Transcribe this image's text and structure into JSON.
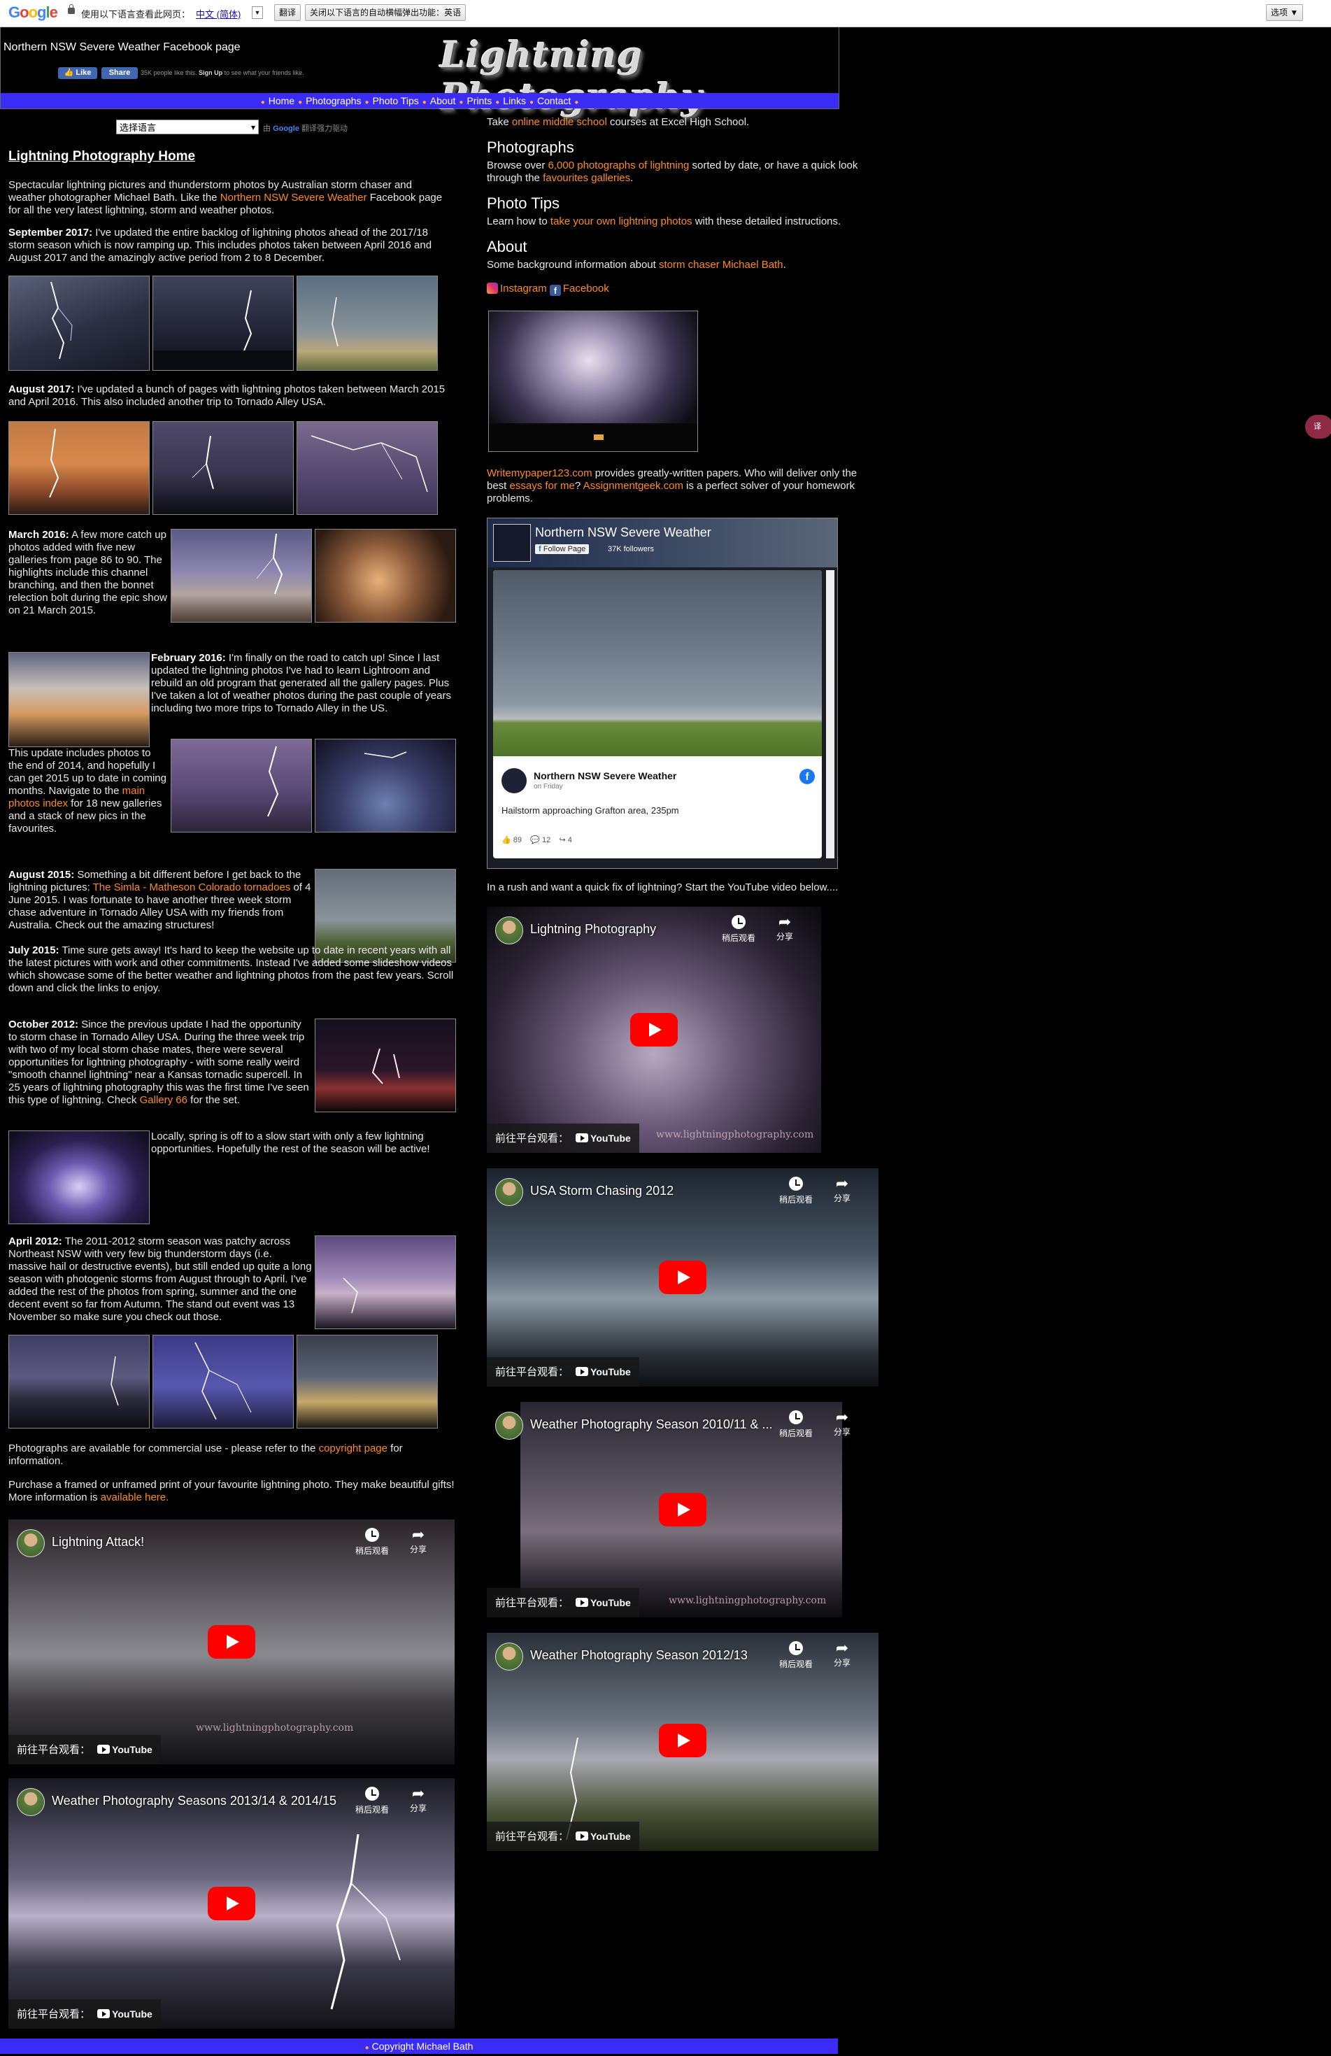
{
  "translate_bar": {
    "logo": "Google",
    "prompt": "使用以下语言查看此网页：",
    "language": "中文 (简体)",
    "translate_button": "翻译",
    "disable_button": "关闭以下语言的自动横幅弹出功能：英语",
    "options_button": "选项 ▼"
  },
  "header": {
    "fb_title": "Northern NSW Severe Weather Facebook page",
    "fb_like": "Like",
    "fb_share": "Share",
    "fb_note_prefix": "35K people like this.",
    "fb_note_signup": "Sign Up",
    "fb_note_suffix": "to see what your friends like.",
    "logo_text": "Lightning Photography"
  },
  "nav": {
    "items": [
      "Home",
      "Photographs",
      "Photo Tips",
      "About",
      "Prints",
      "Links",
      "Contact"
    ]
  },
  "language_select": {
    "value": "选择语言",
    "powered_prefix": "由",
    "powered_brand": "Google",
    "powered_suffix": "翻译强力驱动"
  },
  "main": {
    "home_title": "Lightning Photography Home",
    "intro_1": "Spectacular lightning pictures and thunderstorm photos by Australian storm chaser and weather photographer Michael Bath. Like the",
    "intro_link": "Northern NSW Severe Weather",
    "intro_2": "Facebook page for all the very latest lightning, storm and weather photos.",
    "sep2017_label": "September 2017:",
    "sep2017_text": "I've updated the entire backlog of lightning photos ahead of the 2017/18 storm season which is now ramping up. This includes photos taken between April 2016 and August 2017 and the amazingly active period from 2 to 8 December.",
    "aug2017_label": "August 2017:",
    "aug2017_text": "I've updated a bunch of pages with lightning photos taken between March 2015 and April 2016. This also included another trip to Tornado Alley USA.",
    "mar2016_label": "March 2016:",
    "mar2016_text": "A few more catch up photos added with five new galleries from page 86 to 90. The highlights include this channel branching, and then the bonnet relection bolt during the epic show on 21 March 2015.",
    "feb2016_label": "February 2016:",
    "feb2016_text": "I'm finally on the road to catch up! Since I last updated the lightning photos I've had to learn Lightroom and rebuild an old program that generated all the gallery pages. Plus I've taken a lot of weather photos during the past couple of years including two more trips to Tornado Alley in the US.",
    "feb2016_text2": "This update includes photos to the end of 2014, and hopefully I can get 2015 up to date in coming months. Navigate to the",
    "feb2016_link": "main photos index",
    "feb2016_text3": "for 18 new galleries and a stack of new pics in the favourites.",
    "aug2015_label": "August 2015:",
    "aug2015_text": "Something a bit different before I get back to the lightning pictures:",
    "aug2015_link": "The Simla - Matheson Colorado tornadoes",
    "aug2015_text2": "of 4 June 2015. I was fortunate to have another three week storm chase adventure in Tornado Alley USA with my friends from Australia. Check out the amazing structures!",
    "jul2015_label": "July 2015:",
    "jul2015_text": "Time sure gets away! It's hard to keep the website up to date in recent years with all the latest pictures with work and other commitments. Instead I've added some slideshow videos which showcase some of the better weather and lightning photos from the past few years. Scroll down and click the links to enjoy.",
    "oct2012_label": "October 2012:",
    "oct2012_text": "Since the previous update I had the opportunity to storm chase in Tornado Alley USA. During the three week trip with two of my local storm chase mates, there were several opportunities for lightning photography - with some really weird \"smooth channel lightning\" near a Kansas tornadic supercell. In 25 years of lightning photography this was the first time I've seen this type of lightning. Check",
    "oct2012_link": "Gallery 66",
    "oct2012_text2": "for the set.",
    "spring_text": "Locally, spring is off to a slow start with only a few lightning opportunities. Hopefully the rest of the season will be active!",
    "apr2012_label": "April 2012:",
    "apr2012_text": "The 2011-2012 storm season was patchy across Northeast NSW with very few big thunderstorm days (i.e. massive hail or destructive events), but still ended up quite a long season with photogenic storms from August through to April. I've added the rest of the photos from spring, summer and the one decent event so far from Autumn. The stand out event was 13 November so make sure you check out those.",
    "commercial_text": "Photographs are available for commercial use - please refer to the",
    "commercial_link": "copyright page",
    "commercial_text2": "for information.",
    "purchase_text": "Purchase a framed or unframed print of your favourite lightning photo. They make beautiful gifts! More information is",
    "purchase_link": "available here."
  },
  "sidebar": {
    "course_prefix": "Take",
    "course_link": "online middle school",
    "course_suffix": "courses at Excel High School.",
    "photographs_heading": "Photographs",
    "photographs_prefix": "Browse over",
    "photographs_link": "6,000 photographs of lightning",
    "photographs_mid": "sorted by date, or have a quick look through the",
    "photographs_link2": "favourites galleries",
    "phototips_heading": "Photo Tips",
    "phototips_prefix": "Learn how to",
    "phototips_link": "take your own lightning photos",
    "phototips_suffix": "with these detailed instructions.",
    "about_heading": "About",
    "about_prefix": "Some background information about",
    "about_link": "storm chaser Michael Bath",
    "instagram_label": "Instagram",
    "facebook_label": "Facebook",
    "writemy_link": "Writemypaper123.com",
    "writemy_text": "provides greatly-written papers. Who will deliver only the best",
    "essays_link": "essays for me",
    "assign_link": "Assignmentgeek.com",
    "assign_text": "is a perfect solver of your homework problems.",
    "youtube_intro": "In a rush and want a quick fix of lightning? Start the YouTube video below...."
  },
  "fb_widget": {
    "page_name": "Northern NSW Severe Weather",
    "follow_label": "Follow Page",
    "followers": "37K followers",
    "post_page": "Northern NSW Severe Weather",
    "post_time": "on Friday",
    "caption": "Hailstorm approaching Grafton area, 235pm",
    "likes": "89",
    "comments": "12",
    "shares": "4"
  },
  "videos": {
    "watch_later": "稍后观看",
    "share": "分享",
    "watch_on": "前往平台观看：",
    "youtube": "YouTube",
    "v1_title": "Lightning Photography",
    "v2_title": "USA Storm Chasing 2012",
    "v3_title": "Weather Photography Season 2010/11 & ...",
    "v4_title": "Weather Photography Season 2012/13",
    "v5_title": "Lightning Attack!",
    "v6_title": "Weather Photography Seasons 2013/14 & 2014/15",
    "watermark": "www.lightningphotography.com"
  },
  "footer": {
    "copyright": "Copyright Michael Bath"
  },
  "colors": {
    "link": "#ff8c1a",
    "nav_bar": "#3b2cf5",
    "nav_dot": "#ffa640",
    "youtube_red": "#ff0000"
  }
}
